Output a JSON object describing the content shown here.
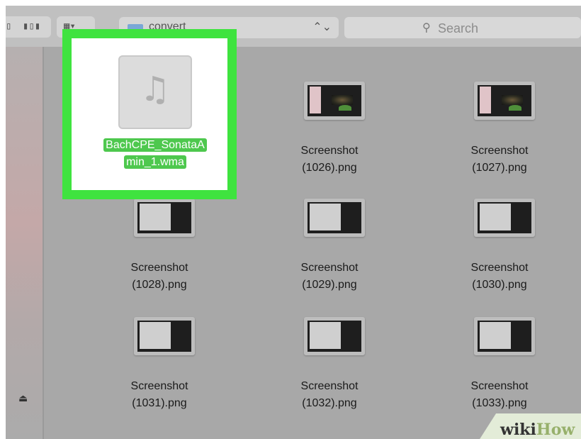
{
  "toolbar": {
    "view_buttons": [
      "icon-view",
      "cover-flow-view",
      "arrange-menu"
    ],
    "path": "convert",
    "search_placeholder": "Search"
  },
  "selected_file": {
    "name_line1": "BachCPE_SonataA",
    "name_line2": "min_1.wma",
    "icon": "music-note-icon",
    "highlight_color": "#3fe33f"
  },
  "files": [
    {
      "line1": "Screenshot",
      "line2": "(1026).png"
    },
    {
      "line1": "Screenshot",
      "line2": "(1027).png"
    },
    {
      "line1": "Screenshot",
      "line2": "(1028).png"
    },
    {
      "line1": "Screenshot",
      "line2": "(1029).png"
    },
    {
      "line1": "Screenshot",
      "line2": "(1030).png"
    },
    {
      "line1": "Screenshot",
      "line2": "(1031).png"
    },
    {
      "line1": "Screenshot",
      "line2": "(1032).png"
    },
    {
      "line1": "Screenshot",
      "line2": "(1033).png"
    }
  ],
  "sidebar": {
    "eject_icon": "eject-icon"
  },
  "watermark": {
    "wiki": "wiki",
    "how": "How"
  }
}
